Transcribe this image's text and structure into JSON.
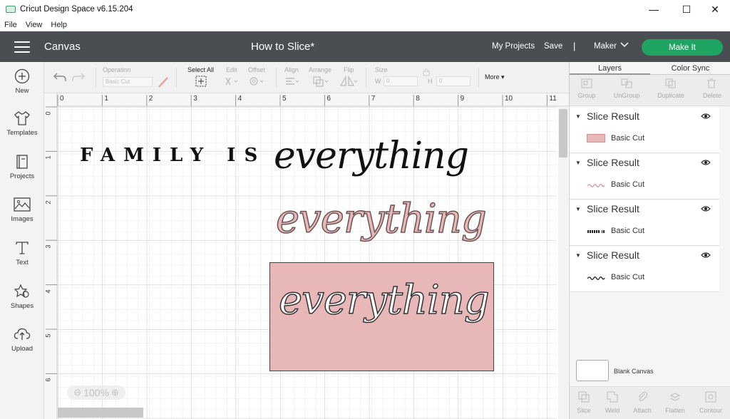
{
  "window": {
    "title": "Cricut Design Space  v6.15.204",
    "minimize": "—",
    "maximize": "☐",
    "close": "✕"
  },
  "menu": [
    "File",
    "View",
    "Help"
  ],
  "header": {
    "canvas_label": "Canvas",
    "project_title": "How to Slice*",
    "my_projects": "My Projects",
    "save": "Save",
    "separator": "|",
    "machine": "Maker",
    "make_it": "Make It",
    "accent_color": "#1fa463"
  },
  "leftbar": {
    "items": [
      {
        "label": "New",
        "icon": "plus-circle-icon"
      },
      {
        "label": "Templates",
        "icon": "shirt-icon"
      },
      {
        "label": "Projects",
        "icon": "book-icon"
      },
      {
        "label": "Images",
        "icon": "image-icon"
      },
      {
        "label": "Text",
        "icon": "text-icon"
      },
      {
        "label": "Shapes",
        "icon": "shapes-icon"
      },
      {
        "label": "Upload",
        "icon": "upload-icon"
      }
    ]
  },
  "toolbar": {
    "operation_label": "Operation",
    "operation_value": "Basic Cut",
    "select_all": "Select All",
    "edit": "Edit",
    "offset": "Offset",
    "align": "Align",
    "arrange": "Arrange",
    "flip": "Flip",
    "size": "Size",
    "w_label": "W",
    "w_value": "0",
    "h_label": "H",
    "h_value": "0",
    "more": "More"
  },
  "canvas": {
    "ruler_top": [
      "0",
      "1",
      "2",
      "3",
      "4",
      "5",
      "6",
      "7",
      "8",
      "9",
      "10",
      "11"
    ],
    "ruler_left": [
      "0",
      "1",
      "2",
      "3",
      "4",
      "5",
      "6"
    ],
    "text_line_1": "FAMILY IS",
    "text_line_1_script": "everything",
    "text_line_2": "everything",
    "text_line_3": "everything",
    "zoom": "100%",
    "pink_color": "#e8b7b8",
    "black_color": "#111111"
  },
  "rightpanel": {
    "tabs": [
      "Layers",
      "Color Sync"
    ],
    "actions": [
      "Group",
      "UnGroup",
      "Duplicate",
      "Delete"
    ],
    "layers": [
      {
        "title": "Slice Result",
        "label": "Basic Cut",
        "thumb": "pink-rect"
      },
      {
        "title": "Slice Result",
        "label": "Basic Cut",
        "thumb": "pink-script"
      },
      {
        "title": "Slice Result",
        "label": "Basic Cut",
        "thumb": "family-text"
      },
      {
        "title": "Slice Result",
        "label": "Basic Cut",
        "thumb": "black-script"
      }
    ],
    "blank_canvas": "Blank Canvas",
    "bottom_actions": [
      "Slice",
      "Weld",
      "Attach",
      "Flatten",
      "Contour"
    ]
  }
}
